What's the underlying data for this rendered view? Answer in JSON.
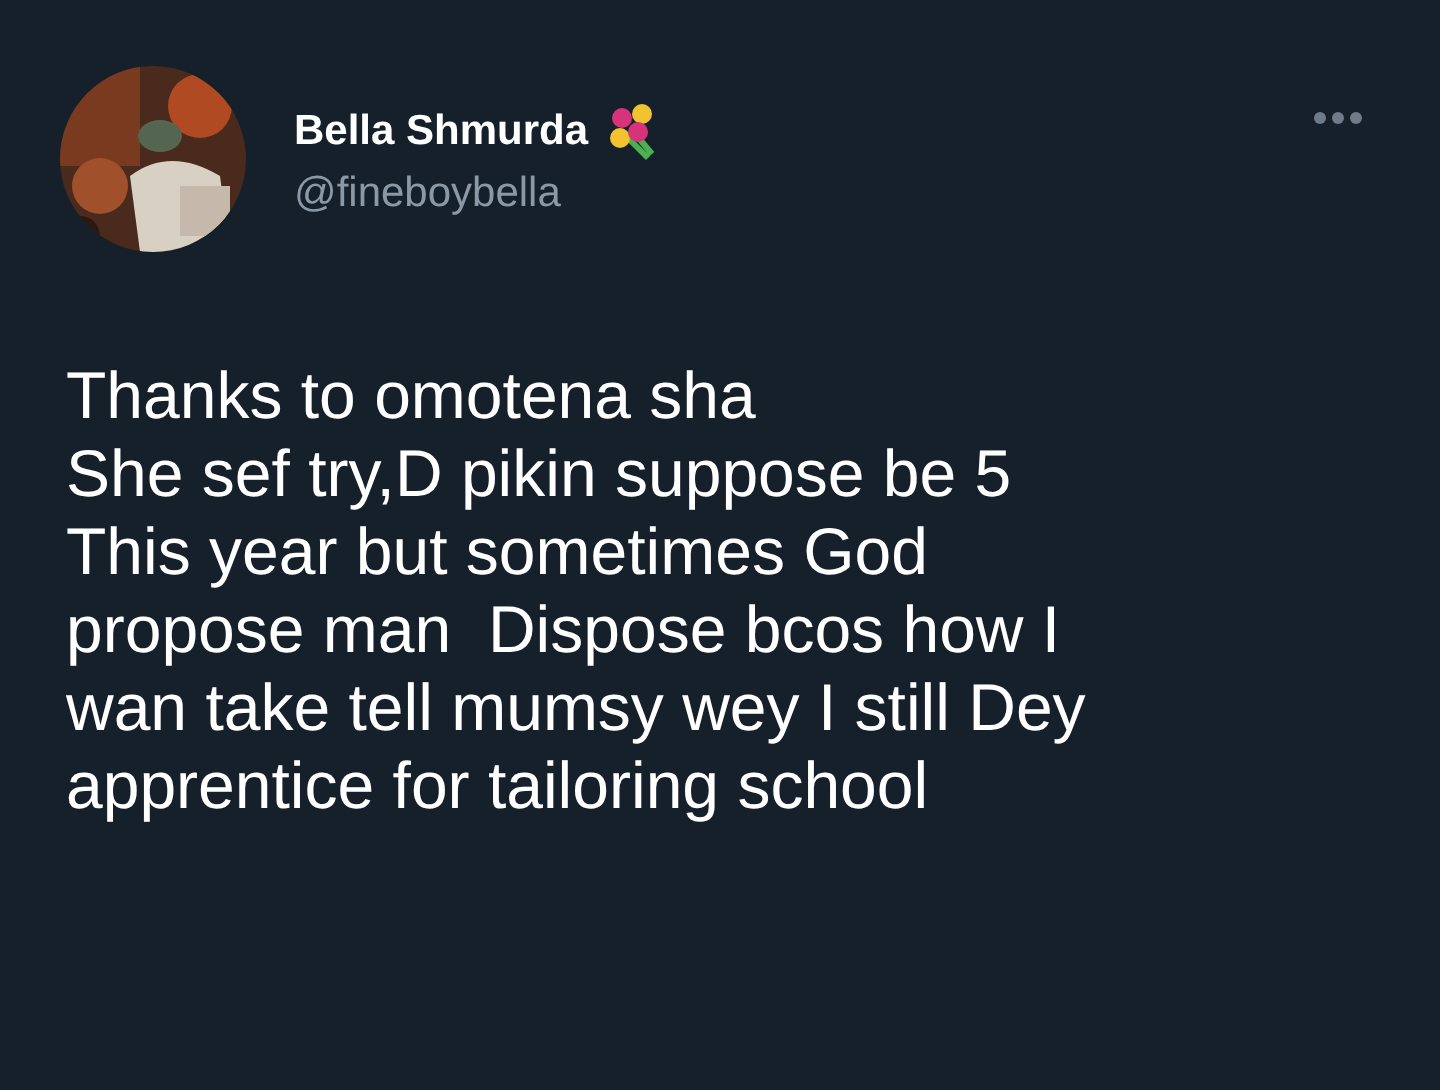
{
  "tweet": {
    "author": {
      "name": "Bella Shmurda",
      "handle": "@fineboybella"
    },
    "lines": [
      "Thanks to omotena sha",
      "She sef try,D pikin suppose be 5",
      "This year but sometimes God",
      "propose man  Dispose bcos how I",
      "wan take tell mumsy wey I still Dey",
      "apprentice for tailoring school"
    ]
  }
}
